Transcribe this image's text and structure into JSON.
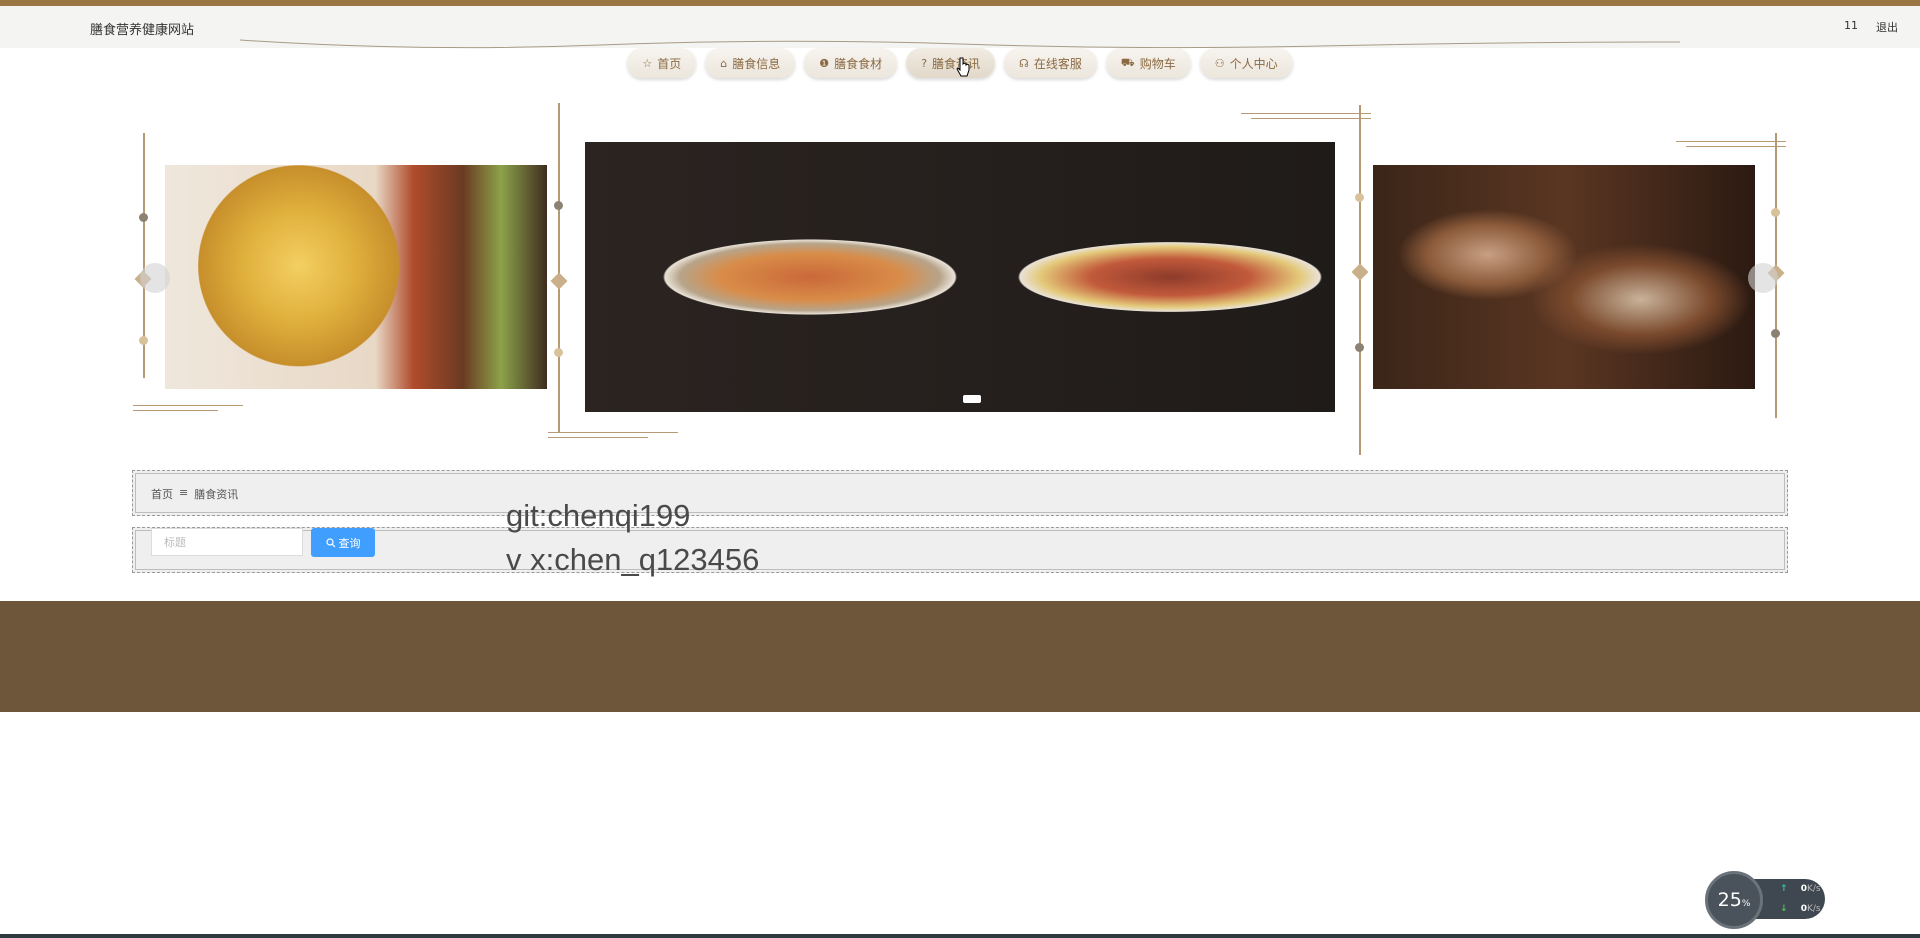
{
  "header": {
    "site_title": "膳食营养健康网站",
    "user": "11",
    "logout": "退出"
  },
  "nav": {
    "items": [
      {
        "icon": "☆",
        "label": "首页"
      },
      {
        "icon": "⌂",
        "label": "膳食信息"
      },
      {
        "icon": "❶",
        "label": "膳食食材"
      },
      {
        "icon": "?",
        "label": "膳食资讯"
      },
      {
        "icon": "☊",
        "label": "在线客服"
      },
      {
        "icon": "⛟",
        "label": "购物车"
      },
      {
        "icon": "⚇",
        "label": "个人中心"
      }
    ],
    "active_index": 3
  },
  "breadcrumb": {
    "home": "首页",
    "separator": "≡",
    "current": "膳食资讯"
  },
  "search": {
    "placeholder": "标题",
    "button": "查询",
    "button_color": "#409eff"
  },
  "watermark": {
    "line1": "git:chenqi199",
    "line2": "v x:chen_q123456"
  },
  "speed_widget": {
    "percent": "25",
    "percent_unit": "%",
    "upload": "0",
    "download": "0",
    "unit": "K/s"
  },
  "colors": {
    "accent": "#9a7645",
    "footer": "#6e563b",
    "nav_text": "#8b6a43"
  }
}
